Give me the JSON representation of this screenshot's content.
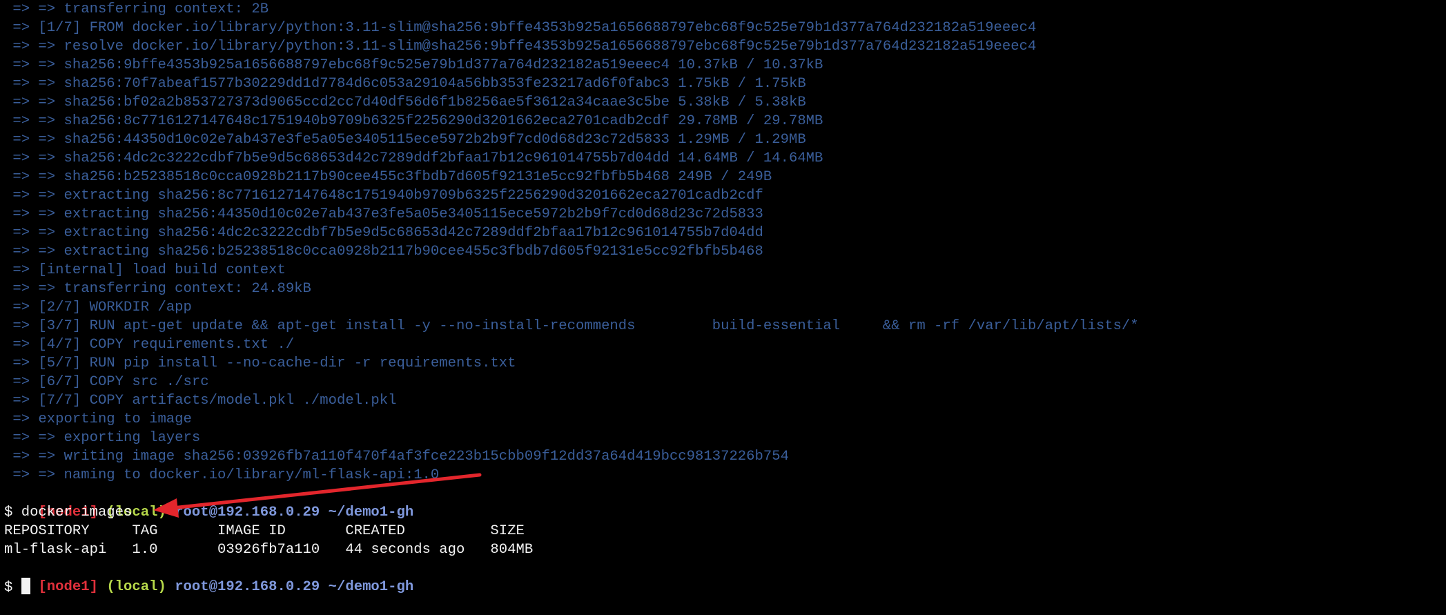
{
  "build_log": [
    " => => transferring context: 2B",
    " => [1/7] FROM docker.io/library/python:3.11-slim@sha256:9bffe4353b925a1656688797ebc68f9c525e79b1d377a764d232182a519eeec4",
    " => => resolve docker.io/library/python:3.11-slim@sha256:9bffe4353b925a1656688797ebc68f9c525e79b1d377a764d232182a519eeec4",
    " => => sha256:9bffe4353b925a1656688797ebc68f9c525e79b1d377a764d232182a519eeec4 10.37kB / 10.37kB",
    " => => sha256:70f7abeaf1577b30229dd1d7784d6c053a29104a56bb353fe23217ad6f0fabc3 1.75kB / 1.75kB",
    " => => sha256:bf02a2b853727373d9065ccd2cc7d40df56d6f1b8256ae5f3612a34caae3c5be 5.38kB / 5.38kB",
    " => => sha256:8c7716127147648c1751940b9709b6325f2256290d3201662eca2701cadb2cdf 29.78MB / 29.78MB",
    " => => sha256:44350d10c02e7ab437e3fe5a05e3405115ece5972b2b9f7cd0d68d23c72d5833 1.29MB / 1.29MB",
    " => => sha256:4dc2c3222cdbf7b5e9d5c68653d42c7289ddf2bfaa17b12c961014755b7d04dd 14.64MB / 14.64MB",
    " => => sha256:b25238518c0cca0928b2117b90cee455c3fbdb7d605f92131e5cc92fbfb5b468 249B / 249B",
    " => => extracting sha256:8c7716127147648c1751940b9709b6325f2256290d3201662eca2701cadb2cdf",
    " => => extracting sha256:44350d10c02e7ab437e3fe5a05e3405115ece5972b2b9f7cd0d68d23c72d5833",
    " => => extracting sha256:4dc2c3222cdbf7b5e9d5c68653d42c7289ddf2bfaa17b12c961014755b7d04dd",
    " => => extracting sha256:b25238518c0cca0928b2117b90cee455c3fbdb7d605f92131e5cc92fbfb5b468",
    " => [internal] load build context",
    " => => transferring context: 24.89kB",
    " => [2/7] WORKDIR /app",
    " => [3/7] RUN apt-get update && apt-get install -y --no-install-recommends         build-essential     && rm -rf /var/lib/apt/lists/*",
    " => [4/7] COPY requirements.txt ./",
    " => [5/7] RUN pip install --no-cache-dir -r requirements.txt",
    " => [6/7] COPY src ./src",
    " => [7/7] COPY artifacts/model.pkl ./model.pkl",
    " => exporting to image",
    " => => exporting layers",
    " => => writing image sha256:03926fb7a110f470f4af3fce223b15cbb09f12dd37a64d419bcc98137226b754",
    " => => naming to docker.io/library/ml-flask-api:1.0"
  ],
  "prompt": {
    "node": "[node1]",
    "env": "(local)",
    "user_host_path": "root@192.168.0.29 ~/demo1-gh"
  },
  "command": "$ docker images",
  "images_table": {
    "header": "REPOSITORY     TAG       IMAGE ID       CREATED          SIZE",
    "rows": [
      "ml-flask-api   1.0       03926fb7a110   44 seconds ago   804MB"
    ]
  },
  "final_prompt_symbol": "$ ",
  "colors": {
    "background": "#000000",
    "build_text": "#3a5e9a",
    "prompt_node": "#e0303b",
    "prompt_env": "#b7d94a",
    "prompt_path": "#7f98dc",
    "annotation_arrow": "#e3262c"
  }
}
